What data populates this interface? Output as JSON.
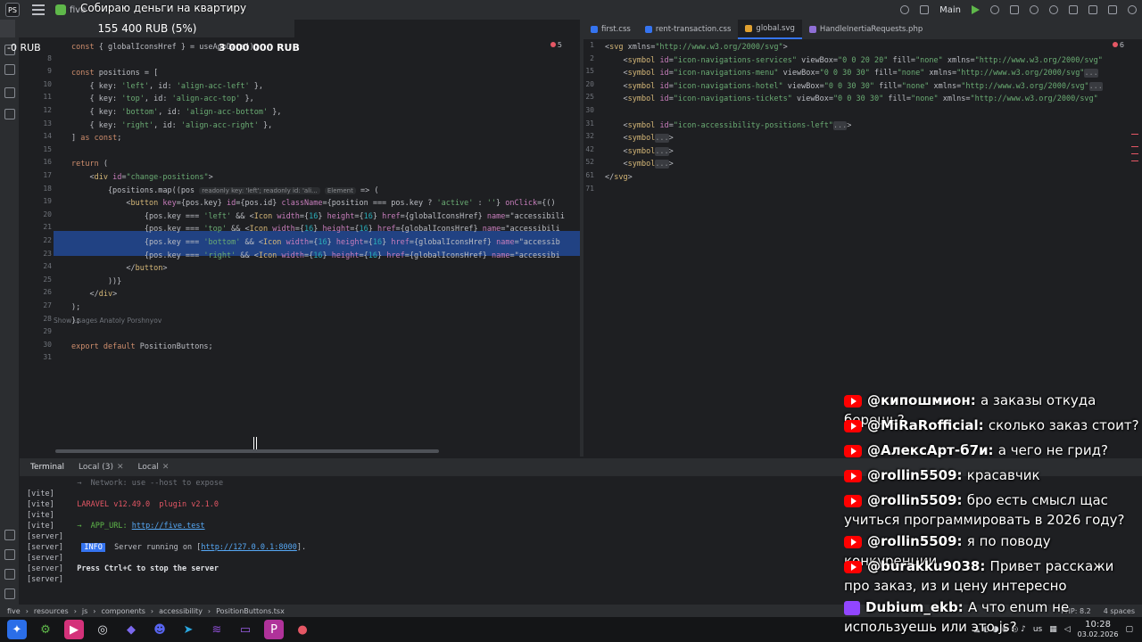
{
  "window": {
    "project": "five",
    "branch": "Main"
  },
  "stream": {
    "donation_title": "Собираю деньги на квартиру",
    "goal_progress": "155 400 RUB (5%)",
    "goal_percent": 5,
    "goal_min": "-0 RUB",
    "goal_max": "3 000 000 RUB"
  },
  "editor_left": {
    "error_count": "5",
    "usages_label": "Show usages",
    "author_label": "Anatoly Porshnyov",
    "line_numbers": [
      "",
      "8",
      "9",
      "10",
      "11",
      "12",
      "13",
      "14",
      "15",
      "16",
      "17",
      "18",
      "19",
      "20",
      "21",
      "22",
      "23",
      "24",
      "25",
      "26",
      "27",
      "28",
      "29",
      "30",
      "31"
    ],
    "lines": [
      "const { globalIconsHref } = useAppData();",
      "",
      "const positions = [",
      "    { key: 'left', id: 'align-acc-left' },",
      "    { key: 'top', id: 'align-acc-top' },",
      "    { key: 'bottom', id: 'align-acc-bottom' },",
      "    { key: 'right', id: 'align-acc-right' },",
      "] as const;",
      "",
      "return (",
      "    <div id=\"change-positions\">",
      "        {positions.map((pos",
      "            <button key={pos.key} id={pos.id} className={position === pos.key ? 'active' : ''} onClick={()",
      "                {pos.key === 'left' && <Icon width={16} height={16} href={globalIconsHref} name=\"accessibili",
      "                {pos.key === 'top' && <Icon width={16} height={16} href={globalIconsHref} name=\"accessibili",
      "                {pos.key === 'bottom' && <Icon width={16} height={16} href={globalIconsHref} name=\"accessib",
      "                {pos.key === 'right' && <Icon width={16} height={16} href={globalIconsHref} name=\"accessibi",
      "            </button>",
      "        ))}",
      "    </div>",
      ");",
      "};",
      "",
      "export default PositionButtons;",
      ""
    ],
    "inlay_hint": "readonly key: 'left'; readonly id: 'ali...",
    "inlay_type": "Element",
    "inlay_arrow": "=> ("
  },
  "editor_right": {
    "tabs": [
      {
        "label": "first.css",
        "color": "#3574f0"
      },
      {
        "label": "rent-transaction.css",
        "color": "#3574f0"
      },
      {
        "label": "global.svg",
        "color": "#e0a030"
      },
      {
        "label": "HandleInertiaRequests.php",
        "color": "#8f6fd6"
      }
    ],
    "error_count": "6",
    "line_numbers": [
      "1",
      "2",
      "15",
      "20",
      "25",
      "30",
      "31",
      "32",
      "42",
      "52",
      "61",
      "71"
    ],
    "lines": [
      "<svg xmlns=\"http://www.w3.org/2000/svg\">",
      "    <symbol id=\"icon-navigations-services\" viewBox=\"0 0 20 20\" fill=\"none\" xmlns=\"http://www.w3.org/2000/svg\"",
      "    <symbol id=\"icon-navigations-menu\" viewBox=\"0 0 30 30\" fill=\"none\" xmlns=\"http://www.w3.org/2000/svg\"...",
      "    <symbol id=\"icon-navigations-hotel\" viewBox=\"0 0 30 30\" fill=\"none\" xmlns=\"http://www.w3.org/2000/svg\"...",
      "    <symbol id=\"icon-navigations-tickets\" viewBox=\"0 0 30 30\" fill=\"none\" xmlns=\"http://www.w3.org/2000/svg\"",
      "",
      "    <symbol id=\"icon-accessibility-positions-left\"...>",
      "    <symbol...>",
      "    <symbol...>",
      "    <symbol...>",
      "</svg>",
      ""
    ]
  },
  "terminal": {
    "tabs": [
      "Terminal",
      "Local (3)",
      "Local"
    ],
    "lines": [
      {
        "prefix": "",
        "text": "  →  Network: use --host to expose"
      },
      {
        "prefix": "[vite]",
        "text": ""
      },
      {
        "prefix": "[vite]",
        "text": "  LARAVEL v12.49.0  plugin v2.1.0"
      },
      {
        "prefix": "[vite]",
        "text": ""
      },
      {
        "prefix": "[vite]",
        "text": "  →  APP_URL: http://five.test"
      },
      {
        "prefix": "[server]",
        "text": ""
      },
      {
        "prefix": "[server]",
        "text": "   INFO  Server running on [http://127.0.0.1:8000]."
      },
      {
        "prefix": "[server]",
        "text": ""
      },
      {
        "prefix": "[server]",
        "text": "  Press Ctrl+C to stop the server"
      },
      {
        "prefix": "[server]",
        "text": ""
      }
    ],
    "app_url": "http://five.test",
    "server_url": "http://127.0.0.1:8000"
  },
  "statusbar": {
    "breadcrumbs": [
      "five",
      "resources",
      "js",
      "components",
      "accessibility",
      "PositionButtons.tsx"
    ],
    "php": "PHP: 8.2",
    "indent": "4 spaces"
  },
  "taskbar": {
    "lang": "us",
    "time": "10:28",
    "date": "03.02.2026"
  },
  "chat": [
    {
      "platform": "youtube",
      "author": "@кипошмион:",
      "text": "а заказы откуда берешь?"
    },
    {
      "platform": "youtube",
      "author": "@MiRaRofficial:",
      "text": "сколько заказ стоит?"
    },
    {
      "platform": "youtube",
      "author": "@АлексАрт-б7и:",
      "text": "а чего не грид?"
    },
    {
      "platform": "youtube",
      "author": "@rollin5509:",
      "text": "красавчик"
    },
    {
      "platform": "youtube",
      "author": "@rollin5509:",
      "text": "бро есть смысл щас учиться программировать в 2026 году?"
    },
    {
      "platform": "youtube",
      "author": "@rollin5509:",
      "text": "я по поводу конкуренции"
    },
    {
      "platform": "youtube",
      "author": "@burakku9038:",
      "text": "Привет расскажи про заказ, из и цену интересно"
    },
    {
      "platform": "twitch",
      "author": "Dubium_ekb:",
      "text": "А что enum не используешь или это js?"
    }
  ]
}
